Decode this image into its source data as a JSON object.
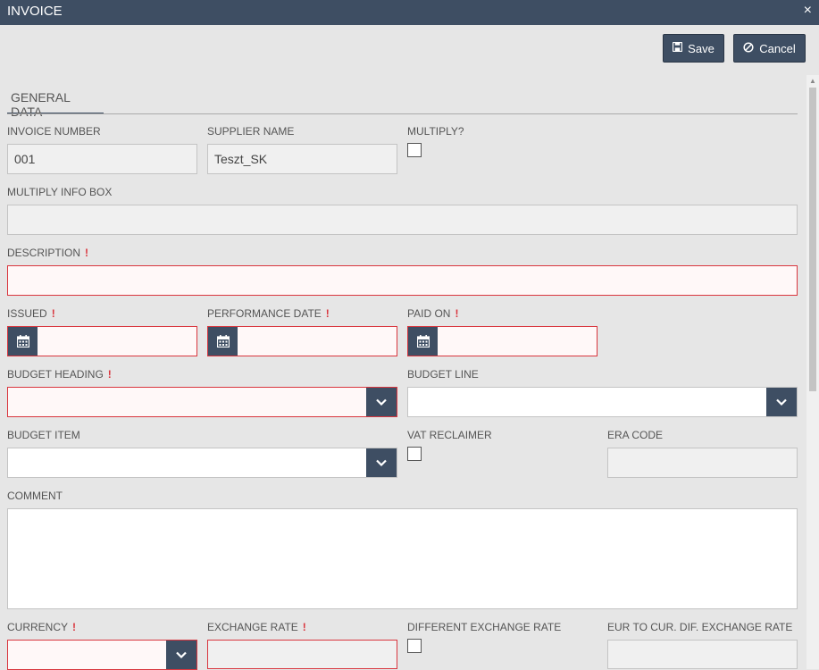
{
  "window": {
    "title": "INVOICE",
    "close_icon": "×"
  },
  "toolbar": {
    "save_label": "Save",
    "cancel_label": "Cancel"
  },
  "tabs": [
    {
      "label": "GENERAL DATA"
    }
  ],
  "fields": {
    "invoice_number": {
      "label": "INVOICE NUMBER",
      "value": "001"
    },
    "supplier_name": {
      "label": "SUPPLIER NAME",
      "value": "Teszt_SK"
    },
    "multiply": {
      "label": "MULTIPLY?"
    },
    "multiply_info_box": {
      "label": "MULTIPLY INFO BOX"
    },
    "description": {
      "label": "DESCRIPTION",
      "required_mark": "!"
    },
    "issued": {
      "label": "ISSUED",
      "required_mark": "!"
    },
    "performance_date": {
      "label": "PERFORMANCE DATE",
      "required_mark": "!"
    },
    "paid_on": {
      "label": "PAID ON",
      "required_mark": "!"
    },
    "budget_heading": {
      "label": "BUDGET HEADING",
      "required_mark": "!"
    },
    "budget_line": {
      "label": "BUDGET LINE"
    },
    "budget_item": {
      "label": "BUDGET ITEM"
    },
    "vat_reclaimer": {
      "label": "VAT RECLAIMER"
    },
    "era_code": {
      "label": "ERA CODE"
    },
    "comment": {
      "label": "COMMENT"
    },
    "currency": {
      "label": "CURRENCY",
      "required_mark": "!"
    },
    "exchange_rate": {
      "label": "EXCHANGE RATE",
      "required_mark": "!"
    },
    "different_exchange_rate": {
      "label": "DIFFERENT EXCHANGE RATE"
    },
    "eur_to_cur_dif_exchange_rate": {
      "label": "EUR TO CUR. DIF. EXCHANGE RATE"
    }
  },
  "icons": {
    "save": "save-icon",
    "cancel": "cancel-icon",
    "calendar": "calendar-icon",
    "dropdown": "chevron-down-icon"
  },
  "colors": {
    "header": "#3e4e63",
    "error": "#d9363e",
    "background": "#e6e6e6"
  }
}
